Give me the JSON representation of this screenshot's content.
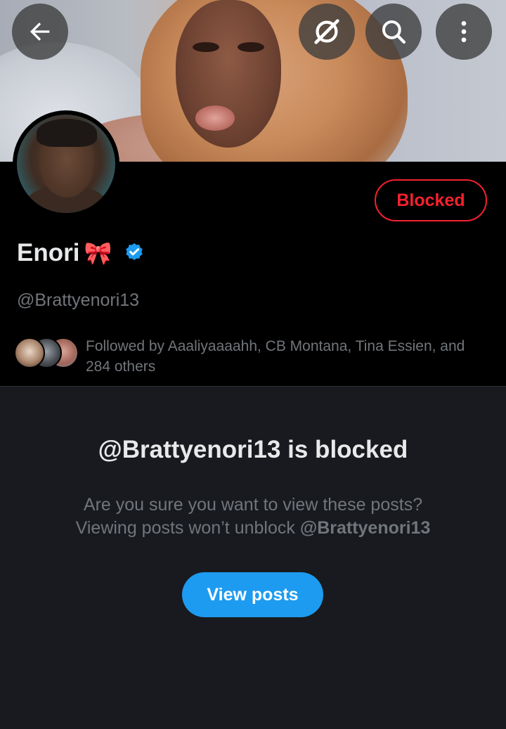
{
  "header": {
    "back_icon": "arrow-left-icon",
    "grok_icon": "grok-icon",
    "search_icon": "search-icon",
    "more_icon": "more-vertical-icon"
  },
  "profile": {
    "display_name": "Enori",
    "name_emoji": "🎀",
    "verified": true,
    "verified_color": "#1d9bf0",
    "handle": "@Brattyenori13",
    "blocked_button_label": "Blocked",
    "blocked_color": "#f4212e",
    "followed_by_text": "Followed by Aaaliyaaaahh, CB Montana, Tina Essien, and\n284 others"
  },
  "blocked_notice": {
    "title": "@Brattyenori13 is blocked",
    "line1": "Are you sure you want to view these posts?",
    "line2_prefix": "Viewing posts won’t unblock ",
    "line2_handle": "@Brattyenori13",
    "view_posts_label": "View posts",
    "button_color": "#1d9bf0"
  }
}
